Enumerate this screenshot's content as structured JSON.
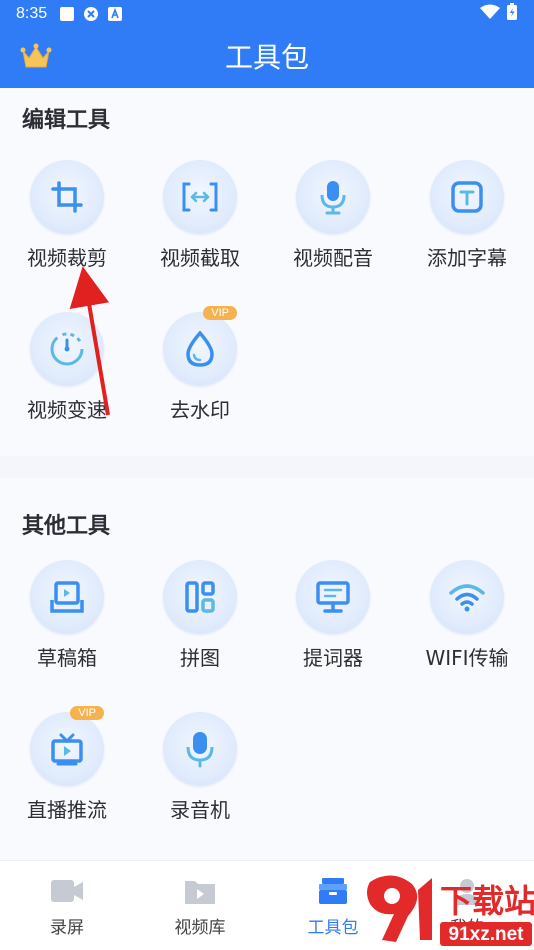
{
  "status_bar": {
    "time": "8:35"
  },
  "app_bar": {
    "title": "工具包",
    "crown_icon": "crown-icon"
  },
  "sections": {
    "edit": {
      "title": "编辑工具",
      "tools": [
        {
          "label": "视频裁剪",
          "icon": "crop-icon",
          "vip": false
        },
        {
          "label": "视频截取",
          "icon": "trim-icon",
          "vip": false
        },
        {
          "label": "视频配音",
          "icon": "microphone-icon",
          "vip": false
        },
        {
          "label": "添加字幕",
          "icon": "text-icon",
          "vip": false
        },
        {
          "label": "视频变速",
          "icon": "speed-icon",
          "vip": false
        },
        {
          "label": "去水印",
          "icon": "water-drop-icon",
          "vip": true
        }
      ]
    },
    "other": {
      "title": "其他工具",
      "tools": [
        {
          "label": "草稿箱",
          "icon": "drafts-icon",
          "vip": false
        },
        {
          "label": "拼图",
          "icon": "collage-icon",
          "vip": false
        },
        {
          "label": "提词器",
          "icon": "teleprompter-icon",
          "vip": false
        },
        {
          "label": "WIFI传输",
          "icon": "wifi-icon",
          "vip": false
        },
        {
          "label": "直播推流",
          "icon": "tv-icon",
          "vip": true
        },
        {
          "label": "录音机",
          "icon": "recorder-mic-icon",
          "vip": false
        }
      ]
    }
  },
  "vip_label": "VIP",
  "tab_bar": {
    "tabs": [
      {
        "label": "录屏",
        "icon": "camera-icon",
        "active": false
      },
      {
        "label": "视频库",
        "icon": "video-library-icon",
        "active": false
      },
      {
        "label": "工具包",
        "icon": "toolbox-icon",
        "active": true
      },
      {
        "label": "我的",
        "icon": "profile-icon",
        "active": false
      }
    ]
  },
  "watermark": {
    "text": "下载站",
    "site": "91xz.net"
  },
  "colors": {
    "primary": "#2f7cf6",
    "vip": "#f5b24e",
    "arrow": "#e0211f"
  }
}
